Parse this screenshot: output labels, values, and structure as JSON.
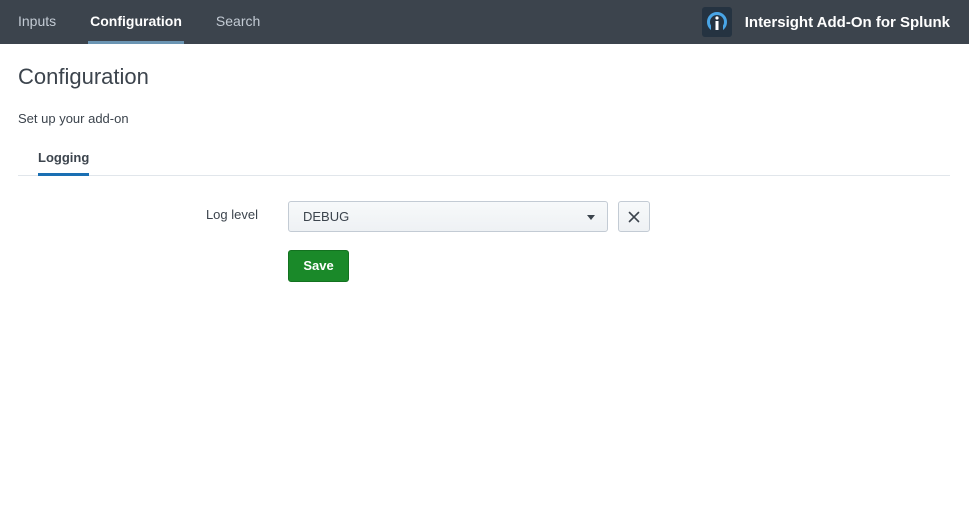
{
  "topbar": {
    "tabs": [
      {
        "label": "Inputs",
        "active": false
      },
      {
        "label": "Configuration",
        "active": true
      },
      {
        "label": "Search",
        "active": false
      }
    ],
    "app_title": "Intersight Add-On for Splunk",
    "logo_icon": "intersight-logo-icon"
  },
  "page": {
    "title": "Configuration",
    "subtitle": "Set up your add-on"
  },
  "tabs": [
    {
      "label": "Logging",
      "active": true
    }
  ],
  "form": {
    "log_level": {
      "label": "Log level",
      "value": "DEBUG",
      "caret_icon": "caret-down-icon",
      "clear_icon": "close-icon"
    },
    "save_label": "Save"
  },
  "colors": {
    "topbar_bg": "#3c444d",
    "active_tab_underline": "#1a6fb3",
    "save_button": "#1a8929"
  }
}
